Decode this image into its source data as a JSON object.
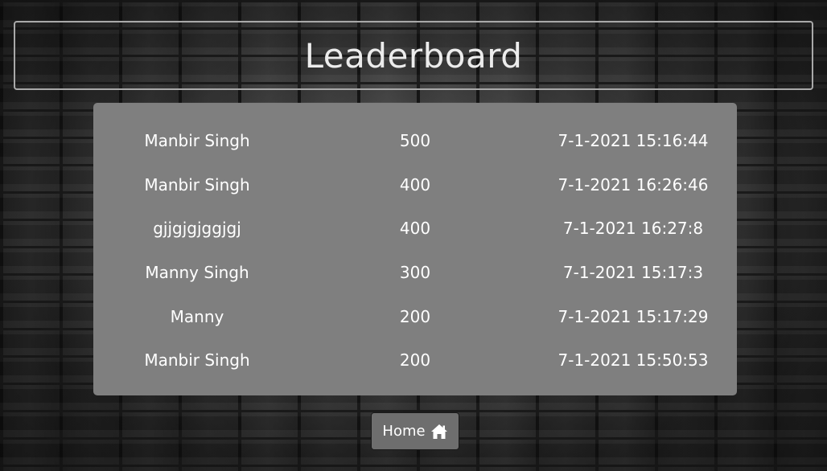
{
  "page": {
    "title": "Leaderboard"
  },
  "leaderboard": {
    "rows": [
      {
        "name": "Manbir Singh",
        "score": "500",
        "time": "7-1-2021 15:16:44"
      },
      {
        "name": "Manbir Singh",
        "score": "400",
        "time": "7-1-2021 16:26:46"
      },
      {
        "name": "gjjgjgjggjgj",
        "score": "400",
        "time": "7-1-2021 16:27:8"
      },
      {
        "name": "Manny Singh",
        "score": "300",
        "time": "7-1-2021 15:17:3"
      },
      {
        "name": "Manny",
        "score": "200",
        "time": "7-1-2021 15:17:29"
      },
      {
        "name": "Manbir Singh",
        "score": "200",
        "time": "7-1-2021 15:50:53"
      }
    ]
  },
  "home_button": {
    "label": "Home",
    "icon": "home-icon"
  },
  "colors": {
    "panel": "#7f7f7f",
    "text": "#ffffff",
    "title_border": "#a9a9a9"
  }
}
